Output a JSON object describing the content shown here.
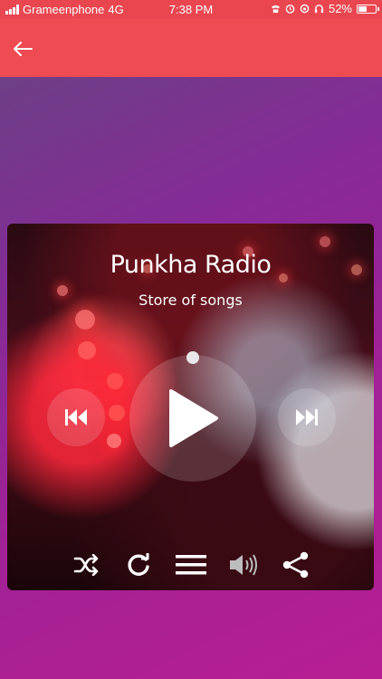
{
  "status_bar": {
    "carrier": "Grameenphone",
    "network": "4G",
    "time": "7:38 PM",
    "battery_percent": "52%",
    "battery_level": 0.52
  },
  "app_bar": {
    "back_icon": "arrow-left-icon",
    "color": "#ee4b52"
  },
  "player": {
    "title": "Punkha Radio",
    "subtitle": "Store of songs",
    "controls": {
      "previous_icon": "skip-previous-icon",
      "play_icon": "play-icon",
      "next_icon": "skip-next-icon"
    },
    "bottom_actions": [
      "shuffle-icon",
      "repeat-icon",
      "playlist-icon",
      "volume-icon",
      "share-icon"
    ]
  },
  "colors": {
    "accent": "#ee4b52",
    "background_top": "#6d3f86",
    "background_bottom": "#b81e93"
  }
}
